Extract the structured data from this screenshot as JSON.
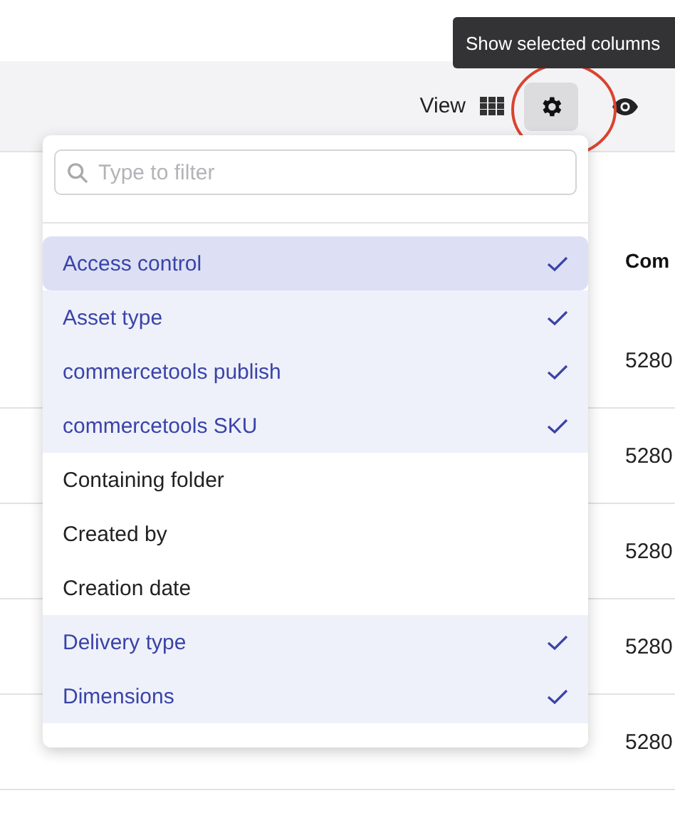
{
  "tooltip": {
    "text": "Show selected columns"
  },
  "toolbar": {
    "view_label": "View"
  },
  "table": {
    "column_header": "Com",
    "rows": [
      "5280",
      "5280",
      "5280",
      "5280",
      "5280"
    ]
  },
  "column_picker": {
    "search": {
      "placeholder": "Type to filter"
    },
    "items": [
      {
        "label": "Access control",
        "checked": true,
        "highlighted": true
      },
      {
        "label": "Asset type",
        "checked": true,
        "highlighted": false
      },
      {
        "label": "commercetools publish",
        "checked": true,
        "highlighted": false
      },
      {
        "label": "commercetools SKU",
        "checked": true,
        "highlighted": false
      },
      {
        "label": "Containing folder",
        "checked": false,
        "highlighted": false
      },
      {
        "label": "Created by",
        "checked": false,
        "highlighted": false
      },
      {
        "label": "Creation date",
        "checked": false,
        "highlighted": false
      },
      {
        "label": "Delivery type",
        "checked": true,
        "highlighted": false
      },
      {
        "label": "Dimensions",
        "checked": true,
        "highlighted": false
      }
    ]
  }
}
